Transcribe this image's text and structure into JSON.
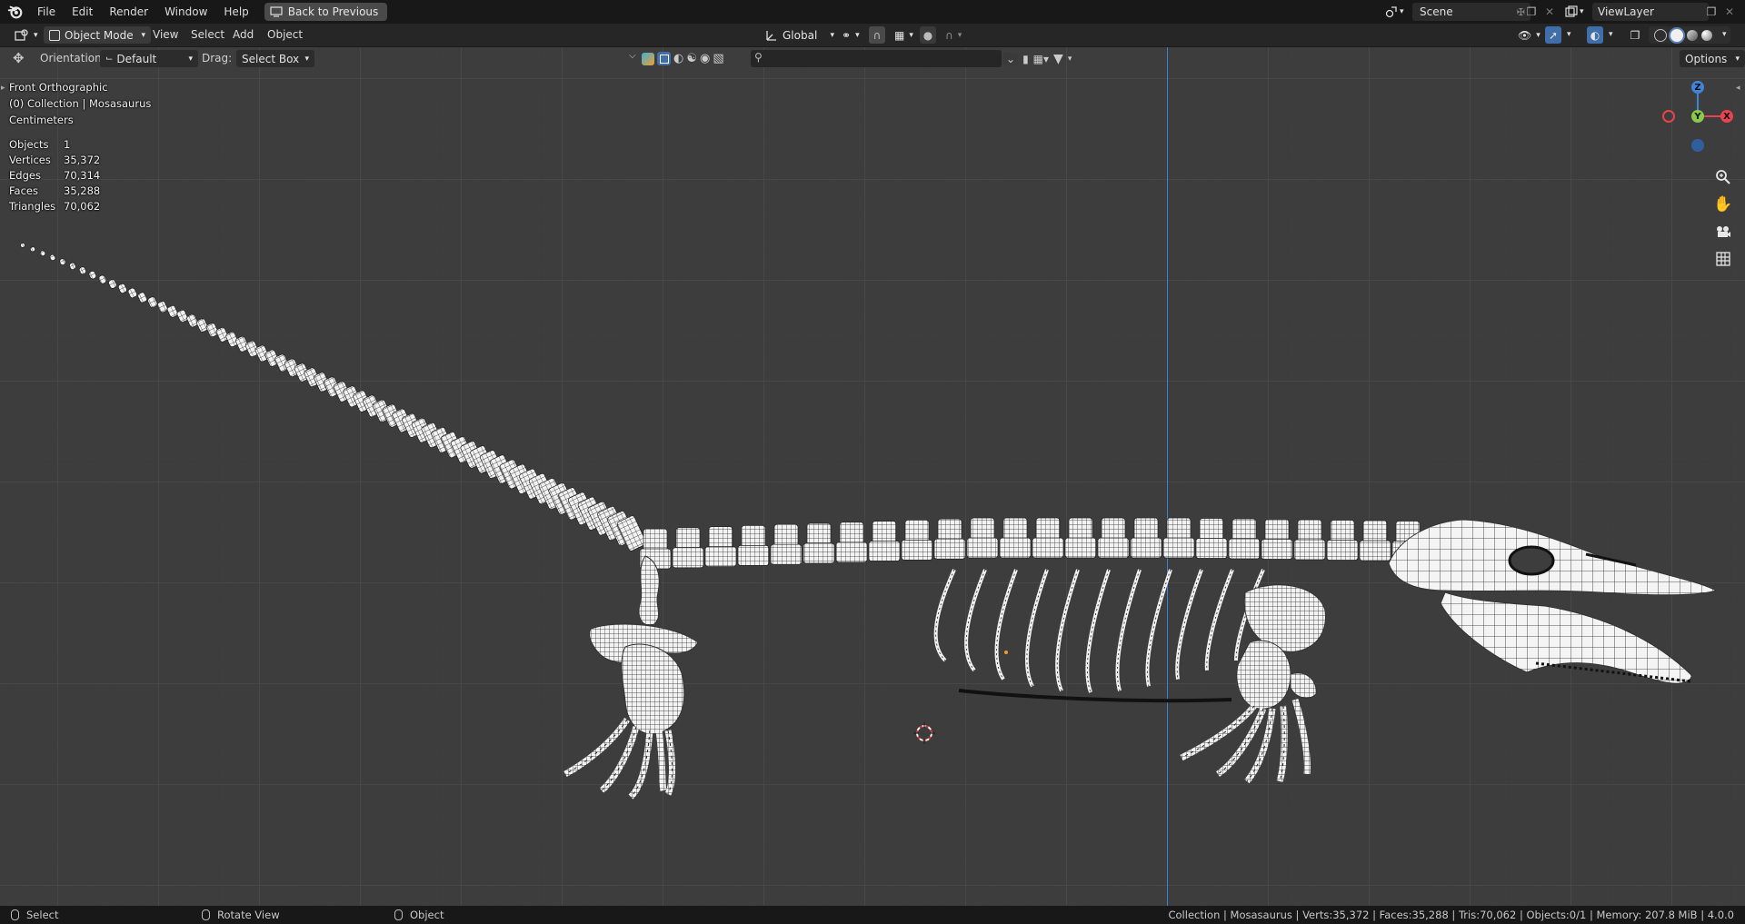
{
  "menu": {
    "items": [
      "File",
      "Edit",
      "Render",
      "Window",
      "Help"
    ],
    "back_label": "Back to Previous",
    "scene": "Scene",
    "view_layer": "ViewLayer"
  },
  "header": {
    "mode": "Object Mode",
    "menus": [
      "View",
      "Select",
      "Add",
      "Object"
    ],
    "transform_orientation": "Global",
    "options_label": "Options"
  },
  "tool_settings": {
    "orientation_label": "Orientation:",
    "orientation_value": "Default",
    "drag_label": "Drag:",
    "drag_value": "Select Box"
  },
  "overlay": {
    "view_name": "Front Orthographic",
    "collection": "(0) Collection | Mosasaurus",
    "units": "Centimeters",
    "stats": [
      {
        "label": "Objects",
        "value": "1"
      },
      {
        "label": "Vertices",
        "value": "35,372"
      },
      {
        "label": "Edges",
        "value": "70,314"
      },
      {
        "label": "Faces",
        "value": "35,288"
      },
      {
        "label": "Triangles",
        "value": "70,062"
      }
    ]
  },
  "gizmo": {
    "z": "Z",
    "y": "Y",
    "x": "X",
    "colors": {
      "x": "#e8434f",
      "y": "#8bc94a",
      "z": "#3f84d8"
    }
  },
  "statusbar": {
    "select": "Select",
    "rotate": "Rotate View",
    "object": "Object",
    "info": "Collection | Mosasaurus | Verts:35,372 | Faces:35,288 | Tris:70,062 | Objects:0/1 | Memory: 207.8 MiB | 4.0.0"
  }
}
